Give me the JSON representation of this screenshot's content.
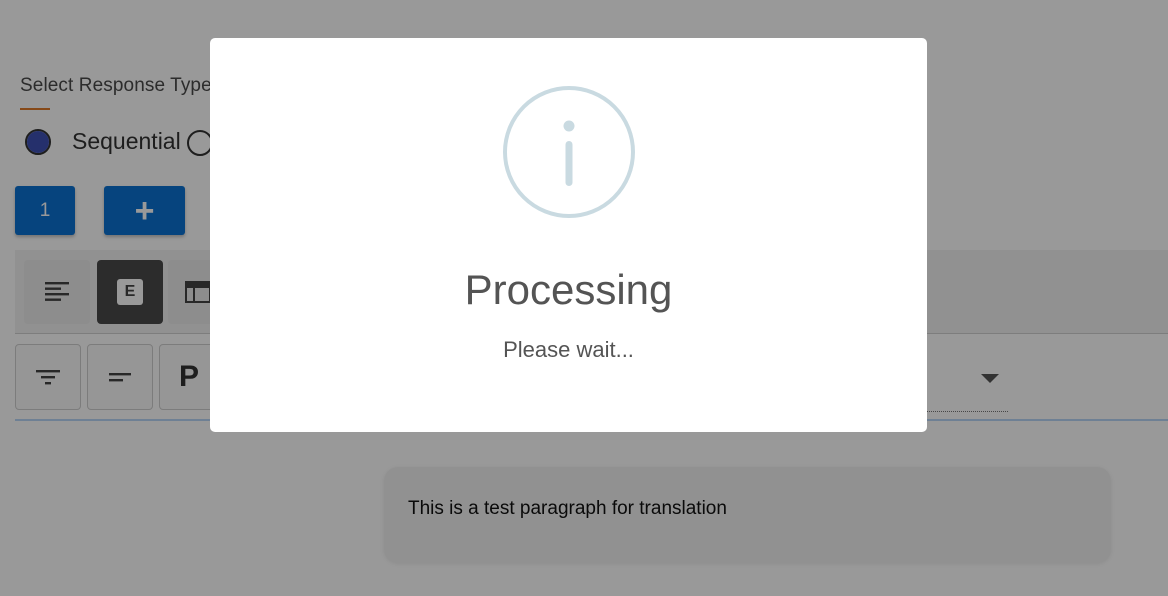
{
  "response_type": {
    "label": "Select Response Type",
    "options": [
      {
        "label": "Sequential",
        "selected": true
      },
      {
        "label": "",
        "selected": false
      }
    ]
  },
  "buttons": {
    "number_label": "1",
    "add_label": "+"
  },
  "toolbar": {
    "e_label": "E",
    "p_label": "P"
  },
  "paragraph": {
    "text": "This is a test paragraph for translation"
  },
  "modal": {
    "icon": "info-icon",
    "title": "Processing",
    "text": "Please wait..."
  },
  "colors": {
    "primary_button": "#0a72d2",
    "radio_selected": "#3f51b5",
    "label_underline": "#e07a28",
    "info_icon": "#c9dae1"
  }
}
